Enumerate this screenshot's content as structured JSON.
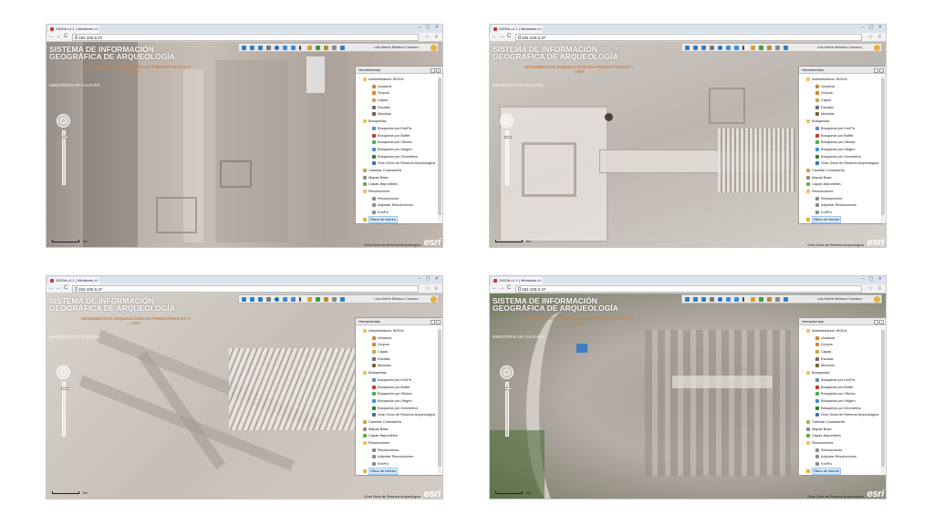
{
  "browser": {
    "tab_title": "SIGDA v1.1 | Ministerio d",
    "tab_close": "×",
    "url": "192.100.5.37",
    "window_controls": "– ▢ ✕",
    "back": "←",
    "forward": "→",
    "reload": "C",
    "nav_right": "☆ ≡"
  },
  "app": {
    "title": "SISTEMA DE INFORMACIÓN GEOGRÁFICA DE ARQUEOLOGÍA",
    "subtitle": "MONUMENTOS ARQUEOLÓGICOS PREHISPÁNICOS Y LIMA",
    "ministry": "MINISTERIO DE CULTURA",
    "user_name": "Luis Alberto Bellasco Carrasco"
  },
  "panel": {
    "title": "Herramientas",
    "minimize": "–",
    "close": "×",
    "selected_item": "Sitios de Interés",
    "items": [
      {
        "label": "Administración SIGDA",
        "level": 0,
        "icon": "folder-icon",
        "color": "#e9c45a",
        "expand": "−"
      },
      {
        "label": "Usuarios",
        "level": 1,
        "icon": "user-icon",
        "color": "#d9822b",
        "expand": ""
      },
      {
        "label": "Grupos",
        "level": 1,
        "icon": "group-icon",
        "color": "#d9822b",
        "expand": ""
      },
      {
        "label": "Capas",
        "level": 1,
        "icon": "layers-icon",
        "color": "#c9a646",
        "expand": ""
      },
      {
        "label": "Escalas",
        "level": 1,
        "icon": "scale-icon",
        "color": "#6d6d6d",
        "expand": ""
      },
      {
        "label": "Módulos",
        "level": 1,
        "icon": "modules-icon",
        "color": "#7b5c3a",
        "expand": ""
      },
      {
        "label": "Búsquedas",
        "level": 0,
        "icon": "folder-icon",
        "color": "#e9c45a",
        "expand": "−"
      },
      {
        "label": "Búsqueda por Km/Pa",
        "level": 1,
        "icon": "globe-icon",
        "color": "#5a8bd0",
        "expand": ""
      },
      {
        "label": "Búsqueda por Buffer",
        "level": 1,
        "icon": "pin-icon",
        "color": "#c0392b",
        "expand": ""
      },
      {
        "label": "Búsqueda por Oficina",
        "level": 1,
        "icon": "globe-icon",
        "color": "#4caf50",
        "expand": ""
      },
      {
        "label": "Búsqueda por Ubigeo",
        "level": 1,
        "icon": "globe-icon",
        "color": "#3f8fd9",
        "expand": ""
      },
      {
        "label": "Búsqueda por Geometría",
        "level": 1,
        "icon": "globe-icon",
        "color": "#2e7d32",
        "expand": ""
      },
      {
        "label": "Gran Zona de Reserva Arqueológica",
        "level": 1,
        "icon": "globe-icon",
        "color": "#3a6fb5",
        "expand": ""
      },
      {
        "label": "Cambiar Contraseña",
        "level": 0,
        "icon": "key-icon",
        "color": "#c9a646",
        "expand": ""
      },
      {
        "label": "Mapas Base",
        "level": 0,
        "icon": "map-icon",
        "color": "#8d8d8d",
        "expand": ""
      },
      {
        "label": "Capas disponibles",
        "level": 0,
        "icon": "layers-icon",
        "color": "#6aa84f",
        "expand": ""
      },
      {
        "label": "Resoluciones",
        "level": 0,
        "icon": "folder-icon",
        "color": "#e9c45a",
        "expand": "−"
      },
      {
        "label": "Resoluciones",
        "level": 1,
        "icon": "document-icon",
        "color": "#8c8c8c",
        "expand": ""
      },
      {
        "label": "Adjuntar Resoluciones",
        "level": 1,
        "icon": "document-icon",
        "color": "#8c8c8c",
        "expand": ""
      },
      {
        "label": "Km/Pa",
        "level": 1,
        "icon": "document-icon",
        "color": "#8c8c8c",
        "expand": ""
      },
      {
        "label": "Sitios de Interés",
        "level": 0,
        "icon": "star-icon",
        "color": "#e0b230",
        "expand": ""
      }
    ]
  },
  "map": {
    "attribution": "Gran Zona de Reserva Arqueológica",
    "logo": "esri",
    "scale_label": "5m"
  },
  "toolbar": {
    "tools": [
      {
        "icon": "zoom-in-icon",
        "color": "#2f7dc2"
      },
      {
        "icon": "zoom-out-icon",
        "color": "#2f7dc2"
      },
      {
        "icon": "zoom-extent-icon",
        "color": "#2f7dc2"
      },
      {
        "icon": "pan-hand-icon",
        "color": "#777777"
      },
      {
        "icon": "globe-icon",
        "color": "#1f6fb8"
      },
      {
        "icon": "undo-icon",
        "color": "#3b8de0"
      },
      {
        "icon": "redo-icon",
        "color": "#3b8de0"
      },
      {
        "icon": "info-icon",
        "color": "#444444"
      },
      {
        "icon": "measure-icon",
        "color": "#d4a22a"
      },
      {
        "icon": "draw-icon",
        "color": "#3c9c3c"
      },
      {
        "icon": "search-icon",
        "color": "#c08a2a"
      },
      {
        "icon": "print-icon",
        "color": "#8a8a8a"
      },
      {
        "icon": "settings-icon",
        "color": "#2f7dc2"
      }
    ]
  },
  "colors": {
    "subtitle": "#c8834c",
    "selection": "#d8ebff",
    "tab_bar": "#dbe3ee"
  }
}
